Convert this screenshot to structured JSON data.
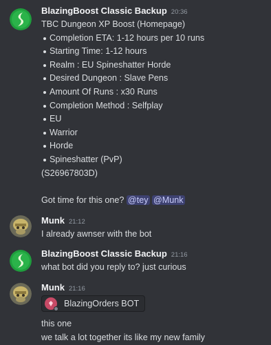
{
  "messages": [
    {
      "username": "BlazingBoost Classic Backup",
      "timestamp": "20:36",
      "title": "TBC Dungeon XP Boost (Homepage)",
      "bullets": [
        "Completion ETA: 1-12 hours per 10 runs",
        "Starting Time: 1-12 hours",
        "Realm : EU Spineshatter Horde",
        "Desired Dungeon : Slave Pens",
        "Amount Of Runs : x30 Runs",
        "Completion Method : Selfplay",
        "EU",
        "Warrior",
        "Horde",
        "Spineshatter (PvP)"
      ],
      "order_id": "(S26967803D)",
      "question": "Got time for this one?",
      "mentions": [
        "@tey",
        "@Munk"
      ]
    },
    {
      "username": "Munk",
      "timestamp": "21:12",
      "text": "I already awnser with the bot"
    },
    {
      "username": "BlazingBoost Classic Backup",
      "timestamp": "21:16",
      "text": "what bot did you reply to? just curious"
    },
    {
      "username": "Munk",
      "timestamp": "21:16",
      "bot_name": "BlazingOrders BOT",
      "lines": [
        "this one",
        "we talk a lot together its like my new family"
      ]
    }
  ],
  "colors": {
    "background": "#313338",
    "text": "#dbdee1",
    "username": "#f2f3f5",
    "timestamp": "#949ba4",
    "mention_bg": "rgba(88,101,242,0.3)",
    "mention_text": "#c9cdfb",
    "brand_avatar": "#1f9e3d",
    "bot_avatar": "#c84a66"
  },
  "icons": {
    "blazingboost_avatar": "blazingboost-logo-icon",
    "munk_avatar": "tauren-helmet-avatar-icon",
    "bot_avatar": "blazingorders-bot-icon"
  }
}
